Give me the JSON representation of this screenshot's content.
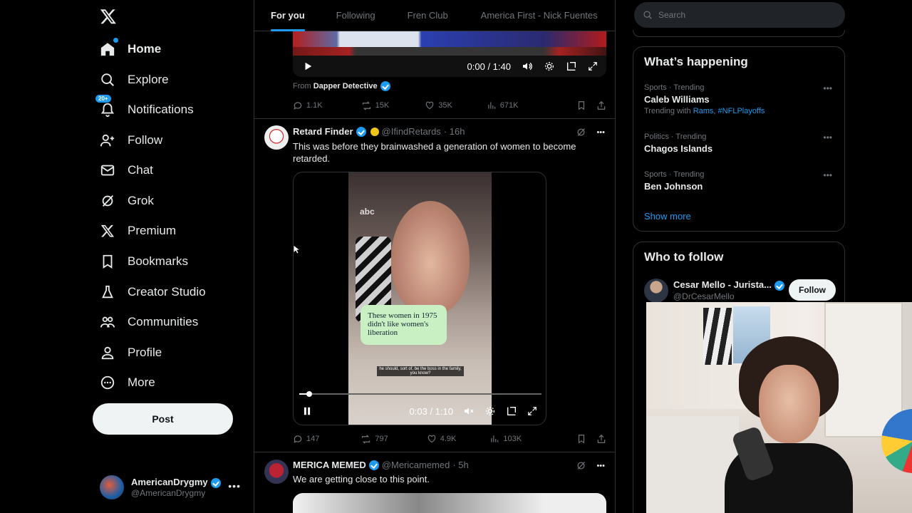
{
  "nav": {
    "items": [
      {
        "label": "Home",
        "icon": "home-icon",
        "active": true
      },
      {
        "label": "Explore",
        "icon": "search-icon"
      },
      {
        "label": "Notifications",
        "icon": "bell-icon",
        "badge": "20+"
      },
      {
        "label": "Follow",
        "icon": "person-add-icon"
      },
      {
        "label": "Chat",
        "icon": "mail-icon"
      },
      {
        "label": "Grok",
        "icon": "grok-icon"
      },
      {
        "label": "Premium",
        "icon": "x-logo-icon"
      },
      {
        "label": "Bookmarks",
        "icon": "bookmark-icon"
      },
      {
        "label": "Creator Studio",
        "icon": "flask-icon"
      },
      {
        "label": "Communities",
        "icon": "people-icon"
      },
      {
        "label": "Profile",
        "icon": "person-icon"
      },
      {
        "label": "More",
        "icon": "more-circle-icon"
      }
    ],
    "post_label": "Post",
    "account": {
      "name": "AmericanDrygmy",
      "handle": "@AmericanDrygmy"
    }
  },
  "tabs": [
    "For you",
    "Following",
    "Fren Club",
    "America First - Nick Fuentes"
  ],
  "tweet1": {
    "video_time": "0:00 / 1:40",
    "from_label": "From",
    "from_name": "Dapper Detective",
    "replies": "1.1K",
    "reposts": "15K",
    "likes": "35K",
    "views": "671K"
  },
  "tweet2": {
    "name": "Retard Finder",
    "handle": "@IfindRetards",
    "time": "· 16h",
    "text": "This was before they brainwashed a generation of women to become retarded.",
    "caption": "These women in 1975 didn't like women's liberation",
    "subtitle": "he should, sort of, be the boss in the family, you know?",
    "watermark": "abc",
    "video_time": "0:03 / 1:10",
    "replies": "147",
    "reposts": "797",
    "likes": "4.9K",
    "views": "103K"
  },
  "tweet3": {
    "name": "MERICA MEMED",
    "handle": "@Mericamemed",
    "time": "· 5h",
    "text": "We are getting close to this point."
  },
  "search": {
    "placeholder": "Search"
  },
  "trending": {
    "title": "What’s happening",
    "items": [
      {
        "meta": "Sports · Trending",
        "title": "Caleb Williams",
        "with_label": "Trending with",
        "with1": "Rams",
        "with2": "#NFLPlayoffs"
      },
      {
        "meta": "Politics · Trending",
        "title": "Chagos Islands"
      },
      {
        "meta": "Sports · Trending",
        "title": "Ben Johnson"
      }
    ],
    "show_more": "Show more"
  },
  "who_to_follow": {
    "title": "Who to follow",
    "name": "Cesar Mello - Jurista...",
    "handle": "@DrCesarMello",
    "follow_label": "Follow"
  },
  "colors": {
    "accent": "#1d9bf0",
    "background": "#000000",
    "border": "#2f3336",
    "muted": "#71767b"
  }
}
